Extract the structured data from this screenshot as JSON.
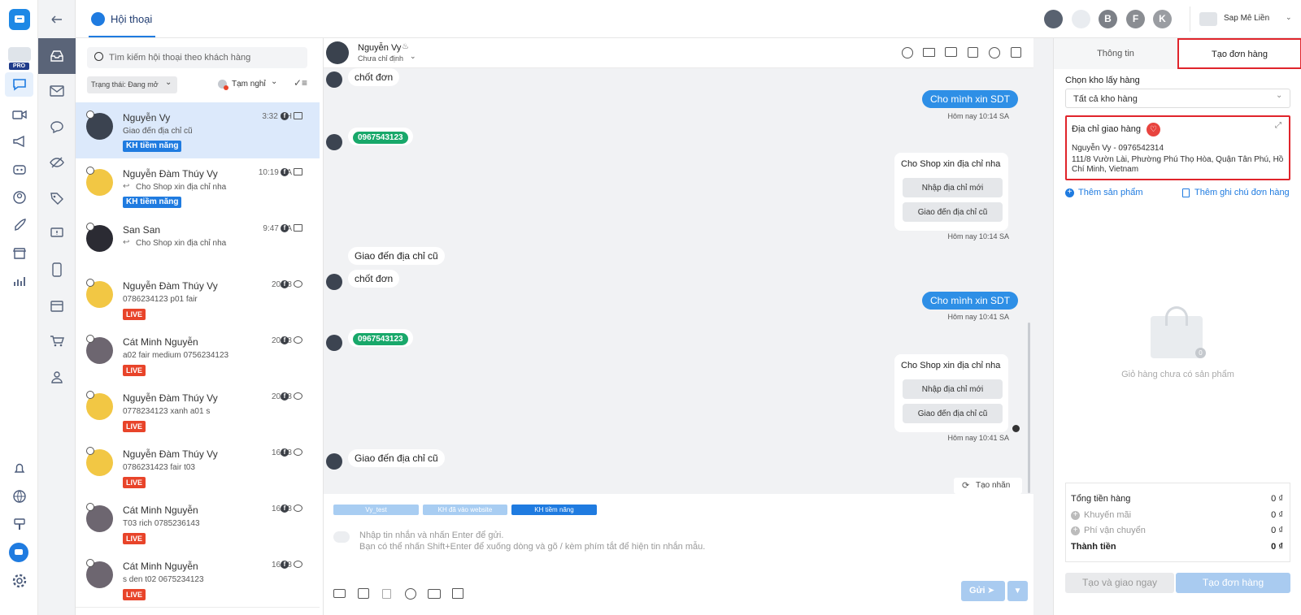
{
  "app": {
    "pro_badge": "PRO"
  },
  "header": {
    "tab_label": "Hội thoại",
    "avatars": [
      "B",
      "F",
      "K"
    ],
    "shop_name": "Sap Mê Liền"
  },
  "list": {
    "search_placeholder": "Tìm kiếm hội thoại theo khách hàng",
    "status_filter": "Trạng thái: Đang mở",
    "presence": "Tạm nghỉ",
    "conversations": [
      {
        "name": "Nguyễn Vy",
        "time": "3:32 CH",
        "preview": "Giao đến địa chỉ cũ",
        "tag": "KH tiềm năng",
        "tag_type": "kh",
        "channel_icon": "mail-icon",
        "reply": false
      },
      {
        "name": "Nguyễn Đàm Thúy Vy",
        "time": "10:19 SA",
        "preview": "Cho Shop xin địa chỉ nha",
        "tag": "KH tiềm năng",
        "tag_type": "kh",
        "channel_icon": "mail-icon",
        "reply": true
      },
      {
        "name": "San San",
        "time": "9:47 SA",
        "preview": "Cho Shop xin địa chỉ nha",
        "tag": "",
        "tag_type": "",
        "channel_icon": "mail-icon",
        "reply": true
      },
      {
        "name": "Nguyễn Đàm Thúy Vy",
        "time": "20/08",
        "preview": "0786234123 p01 fair",
        "tag": "LIVE",
        "tag_type": "live",
        "channel_icon": "comment-icon",
        "reply": false
      },
      {
        "name": "Cát Minh Nguyễn",
        "time": "20/08",
        "preview": "a02 fair medium 0756234123",
        "tag": "LIVE",
        "tag_type": "live",
        "channel_icon": "comment-icon",
        "reply": false
      },
      {
        "name": "Nguyễn Đàm Thúy Vy",
        "time": "20/08",
        "preview": "0778234123 xanh a01 s",
        "tag": "LIVE",
        "tag_type": "live",
        "channel_icon": "comment-icon",
        "reply": false
      },
      {
        "name": "Nguyễn Đàm Thúy Vy",
        "time": "16/08",
        "preview": "0786231423 fair t03",
        "tag": "LIVE",
        "tag_type": "live",
        "channel_icon": "comment-icon",
        "reply": false
      },
      {
        "name": "Cát Minh Nguyễn",
        "time": "16/08",
        "preview": "T03 rich 0785236143",
        "tag": "LIVE",
        "tag_type": "live",
        "channel_icon": "comment-icon",
        "reply": false
      },
      {
        "name": "Cát Minh Nguyễn",
        "time": "16/08",
        "preview": "s den t02 0675234123",
        "tag": "LIVE",
        "tag_type": "live",
        "channel_icon": "comment-icon",
        "reply": false
      }
    ]
  },
  "chat": {
    "contact_name": "Nguyễn Vy",
    "assign_label": "Chưa chỉ định",
    "messages": {
      "m1": "chốt đơn",
      "m2": "Cho mình xin SDT",
      "ts1": "Hôm nay 10:14 SA",
      "phone1": "0967543123",
      "card1_title": "Cho Shop xin địa chỉ nha",
      "card1_btn1": "Nhập địa chỉ mới",
      "card1_btn2": "Giao đến địa chỉ cũ",
      "ts2": "Hôm nay 10:14 SA",
      "m3": "Giao đến địa chỉ cũ",
      "m4": "chốt đơn",
      "m5": "Cho mình xin SDT",
      "ts3": "Hôm nay 10:41 SA",
      "phone2": "0967543123",
      "card2_title": "Cho Shop xin địa chỉ nha",
      "card2_btn1": "Nhập địa chỉ mới",
      "card2_btn2": "Giao đến địa chỉ cũ",
      "ts4": "Hôm nay 10:41 SA",
      "m6": "Giao đến địa chỉ cũ"
    },
    "create_tag": "Tạo nhãn",
    "tags": [
      "Vy_test",
      "KH đã vào website",
      "KH tiềm năng"
    ],
    "input_placeholder_1": "Nhập tin nhắn và nhấn Enter để gửi.",
    "input_placeholder_2": "Bạn có thể nhấn Shift+Enter để xuống dòng và gõ / kèm phím tắt để hiện tin nhắn mẫu.",
    "send_label": "Gửi"
  },
  "order": {
    "tab_info": "Thông tin",
    "tab_create": "Tạo đơn hàng",
    "warehouse_label": "Chọn kho lấy hàng",
    "warehouse_value": "Tất cả kho hàng",
    "address_title": "Địa chỉ giao hàng",
    "address_contact": "Nguyễn Vy - 0976542314",
    "address_line": "111/8 Vườn Lài, Phường Phú Thọ Hòa, Quận Tân Phú, Hồ Chí Minh, Vietnam",
    "add_product": "Thêm sản phẩm",
    "add_note": "Thêm ghi chú đơn hàng",
    "cart_count": "0",
    "cart_empty": "Giỏ hàng chưa có sản phẩm",
    "subtotal_label": "Tổng tiền hàng",
    "subtotal_value": "0 ₫",
    "discount_label": "Khuyến mãi",
    "discount_value": "0 ₫",
    "shipping_label": "Phí vận chuyển",
    "shipping_value": "0 ₫",
    "total_label": "Thành tiền",
    "total_value": "0 ₫",
    "btn_create_ship": "Tạo và giao ngay",
    "btn_create": "Tạo đơn hàng"
  },
  "colors": {
    "accent": "#1f7be0",
    "live": "#e8442a",
    "phone": "#18a86a",
    "highlight_border": "#e0242b"
  }
}
